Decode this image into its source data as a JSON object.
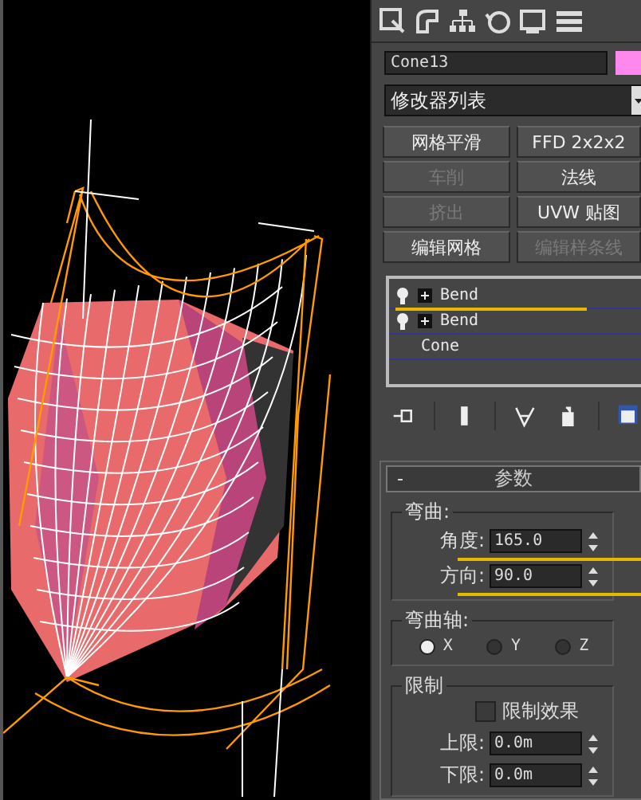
{
  "object_name": {
    "value": "Cone13"
  },
  "modifier_list": {
    "value": "修改器列表"
  },
  "modifier_buttons": [
    {
      "label": "网格平滑",
      "disabled": false
    },
    {
      "label": "FFD 2x2x2",
      "disabled": false
    },
    {
      "label": "车削",
      "disabled": true
    },
    {
      "label": "法线",
      "disabled": false
    },
    {
      "label": "挤出",
      "disabled": true
    },
    {
      "label": "UVW 贴图",
      "disabled": false
    },
    {
      "label": "编辑网格",
      "disabled": false
    },
    {
      "label": "编辑样条线",
      "disabled": true
    }
  ],
  "modifier_stack": [
    {
      "label": "Bend",
      "kind": "modifier",
      "underlined": true
    },
    {
      "label": "Bend",
      "kind": "modifier",
      "underlined": false
    },
    {
      "label": "Cone",
      "kind": "object",
      "underlined": false
    }
  ],
  "rollout": {
    "toggle": "-",
    "title": "参数",
    "bend": {
      "title": "弯曲:",
      "fields": [
        {
          "label": "角度:",
          "value": "165.0",
          "underlined": true
        },
        {
          "label": "方向:",
          "value": "90.0",
          "underlined": true
        }
      ]
    },
    "bend_axis": {
      "title": "弯曲轴:",
      "options": [
        {
          "label": "X",
          "selected": true
        },
        {
          "label": "Y",
          "selected": false
        },
        {
          "label": "Z",
          "selected": false
        }
      ]
    },
    "limits": {
      "title": "限制",
      "checkbox": {
        "label": "限制效果",
        "checked": false
      },
      "fields": [
        {
          "label": "上限:",
          "value": "0.0m",
          "underlined": false
        },
        {
          "label": "下限:",
          "value": "0.0m",
          "underlined": false
        }
      ]
    }
  }
}
